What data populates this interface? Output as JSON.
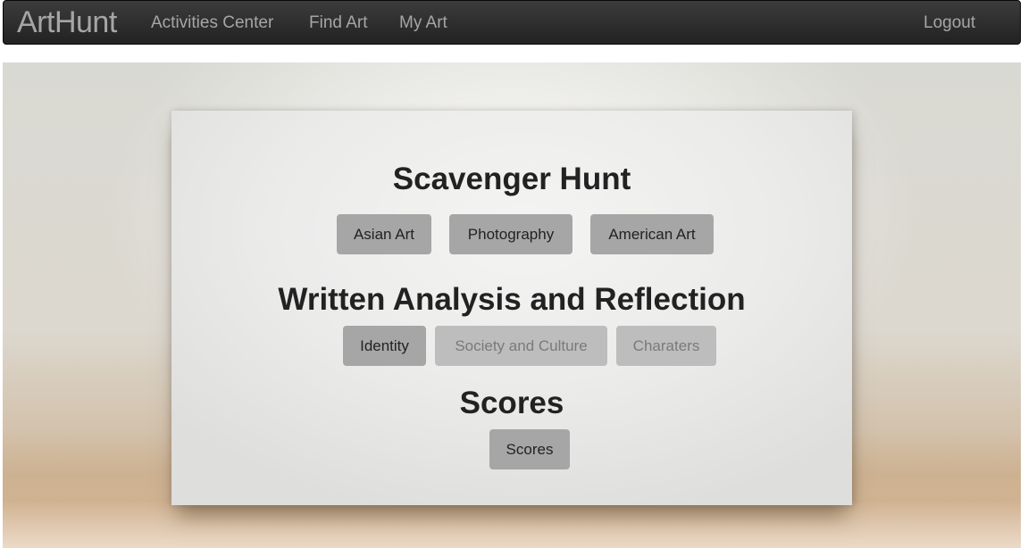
{
  "navbar": {
    "brand": "ArtHunt",
    "links": [
      "Activities Center",
      "Find Art",
      "My Art"
    ],
    "logout": "Logout"
  },
  "sections": {
    "scavenger": {
      "title": "Scavenger Hunt",
      "buttons": [
        "Asian Art",
        "Photography",
        "American Art"
      ]
    },
    "written": {
      "title": "Written Analysis and Reflection",
      "buttons": [
        "Identity",
        "Society and Culture",
        "Charaters"
      ]
    },
    "scores": {
      "title": "Scores",
      "buttons": [
        "Scores"
      ]
    }
  },
  "colors": {
    "navbar_bg": "#222222",
    "nav_text": "#a6a6a6",
    "button_bg": "#a6a6a6",
    "button_disabled_bg": "#bdbdbd"
  }
}
